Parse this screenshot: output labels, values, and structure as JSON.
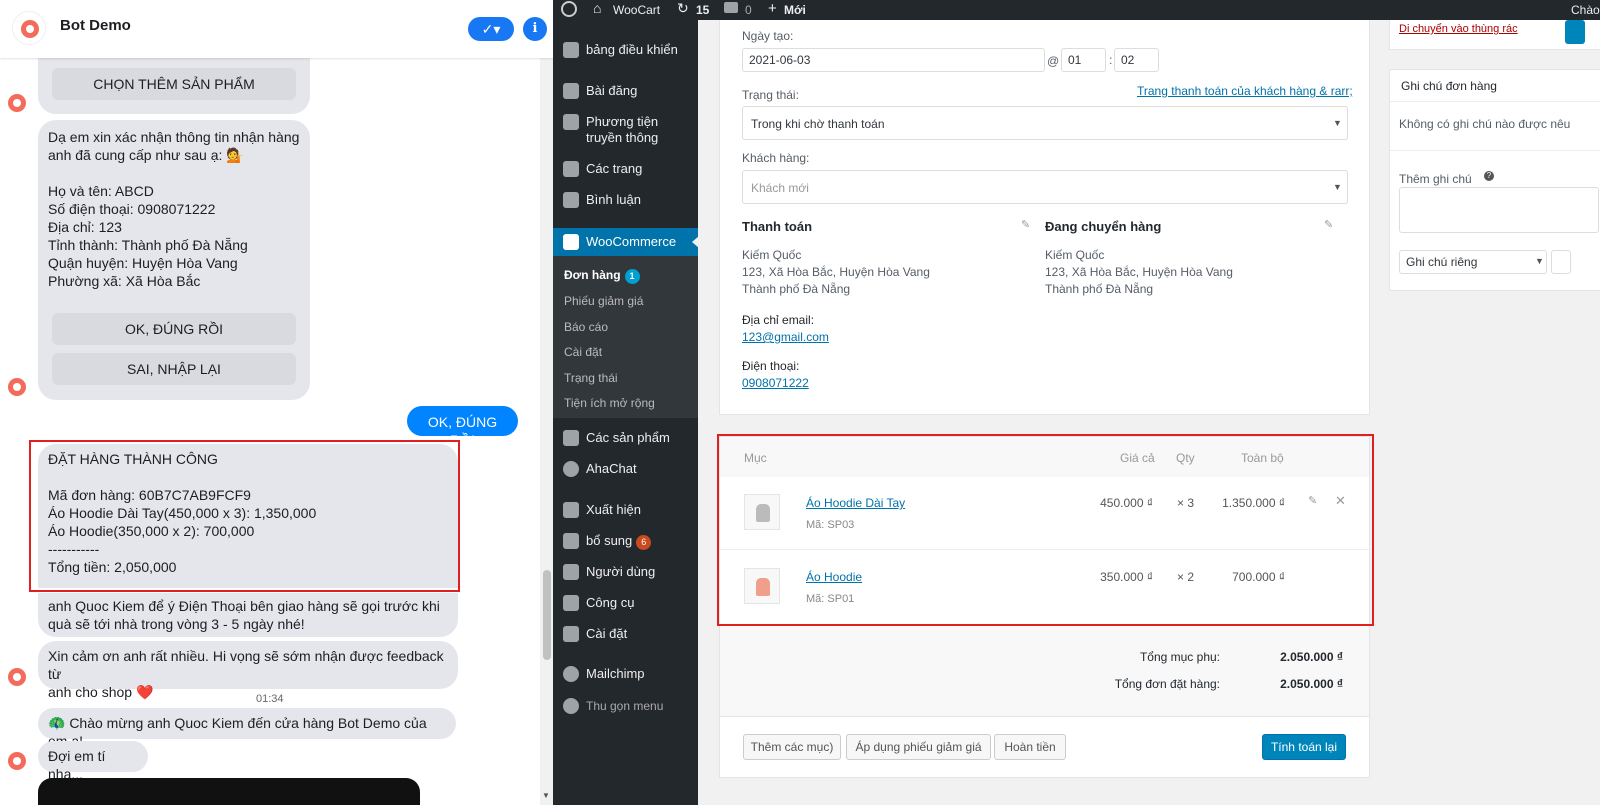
{
  "messenger": {
    "title": "Bot Demo",
    "check_label": "✓▾",
    "info_label": "i",
    "btn_choose_more": "CHỌN THÊM SẢN PHẨM",
    "confirm_text": "Dạ em xin xác nhận thông tin nhận hàng\nanh đã cung cấp như sau ạ: 💁\n\nHọ và tên: ABCD\nSố điện thoại: 0908071222\nĐịa chỉ: 123\nTỉnh thành: Thành phố Đà Nẵng\nQuận huyện: Huyện Hòa Vang\nPhường xã: Xã Hòa Bắc",
    "btn_ok": "OK, ĐÚNG RỒI",
    "btn_retry": "SAI, NHẬP LẠI",
    "user_reply": "OK, ĐÚNG RỒI",
    "order_text": "ĐẶT HÀNG THÀNH CÔNG\n\nMã đơn hàng: 60B7C7AB9FCF9\nÁo Hoodie Dài Tay(450,000 x 3): 1,350,000\nÁo Hoodie(350,000 x 2): 700,000\n-----------\nTổng tiền: 2,050,000",
    "delivery_text": "anh Quoc Kiem để ý Điện Thoại bên giao hàng sẽ gọi trước khi\nquà sẽ tới nhà trong vòng 3 - 5 ngày nhé!",
    "thanks_text": "Xin cảm ơn anh rất nhiều. Hi vọng sẽ sớm nhận được feedback từ\nanh cho shop ❤️",
    "timestamp": "01:34",
    "welcome_text": "🦚 Chào mừng anh Quoc Kiem đến cửa hàng Bot Demo của em ạ!",
    "wait_text": "Đợi em tí nha..."
  },
  "adminbar": {
    "site": "WooCart",
    "updates": "15",
    "comments": "0",
    "new": "Mới",
    "greeting": "Chào"
  },
  "menu": {
    "dashboard": "bảng điều khiển",
    "posts": "Bài đăng",
    "media": "Phương tiện truyền thông",
    "pages": "Các trang",
    "comments": "Bình luận",
    "woocommerce": "WooCommerce",
    "sub": {
      "orders": "Đơn hàng",
      "orders_badge": "1",
      "coupons": "Phiếu giảm giá",
      "reports": "Báo cáo",
      "settings": "Cài đặt",
      "status": "Trạng thái",
      "extensions": "Tiện ích mở rộng"
    },
    "products": "Các sản phẩm",
    "ahachat": "AhaChat",
    "appearance": "Xuất hiện",
    "plugins": "bổ sung",
    "plugins_badge": "6",
    "users": "Người dùng",
    "tools": "Công cụ",
    "settings": "Cài đặt",
    "mailchimp": "Mailchimp",
    "collapse": "Thu gọn menu"
  },
  "order": {
    "date_label": "Ngày tạo:",
    "date": "2021-06-03",
    "at": "@",
    "hour": "01",
    "colon": ":",
    "minute": "02",
    "status_label": "Trạng thái:",
    "payment_link": "Trang thanh toán của khách hàng & rarr;",
    "status_value": "Trong khi chờ thanh toán",
    "customer_label": "Khách hàng:",
    "customer_value": "Khách mới",
    "billing_title": "Thanh toán",
    "shipping_title": "Đang chuyển hàng",
    "billing_addr": "Kiếm Quốc\n123, Xã Hòa Bắc, Huyện Hòa Vang\nThành phố Đà Nẵng",
    "shipping_addr": "Kiếm Quốc\n123, Xã Hòa Bắc, Huyện Hòa Vang\nThành phố Đà Nẵng",
    "email_label": "Địa chỉ email:",
    "email": "123@gmail.com",
    "phone_label": "Điện thoại:",
    "phone": "0908071222"
  },
  "items": {
    "head_item": "Mục",
    "head_price": "Giá cả",
    "head_qty": "Qty",
    "head_total": "Toàn bộ",
    "rows": [
      {
        "name": "Áo Hoodie Dài Tay",
        "sku": "Mã: SP03",
        "price": "450.000 ₫",
        "qty": "× 3",
        "total": "1.350.000 ₫"
      },
      {
        "name": "Áo Hoodie",
        "sku": "Mã: SP01",
        "price": "350.000 ₫",
        "qty": "× 2",
        "total": "700.000 ₫"
      }
    ],
    "subtotal_label": "Tổng mục phụ:",
    "subtotal": "2.050.000 ₫",
    "order_total_label": "Tổng đơn đặt hàng:",
    "order_total": "2.050.000 ₫",
    "btn_add": "Thêm các mục)",
    "btn_coupon": "Áp dụng phiếu giảm giá",
    "btn_refund": "Hoàn tiền",
    "btn_recalc": "Tính toán lại"
  },
  "sidebar": {
    "trash_link": "Di chuyển vào thùng rác",
    "notes_title": "Ghi chú đơn hàng",
    "no_notes": "Không có ghi chú nào được nêu",
    "add_note_label": "Thêm ghi chú",
    "note_type": "Ghi chú riêng"
  },
  "colors": {
    "messenger_blue": "#0084ff",
    "wp_blue": "#0073aa",
    "highlight_red": "#e02020"
  }
}
